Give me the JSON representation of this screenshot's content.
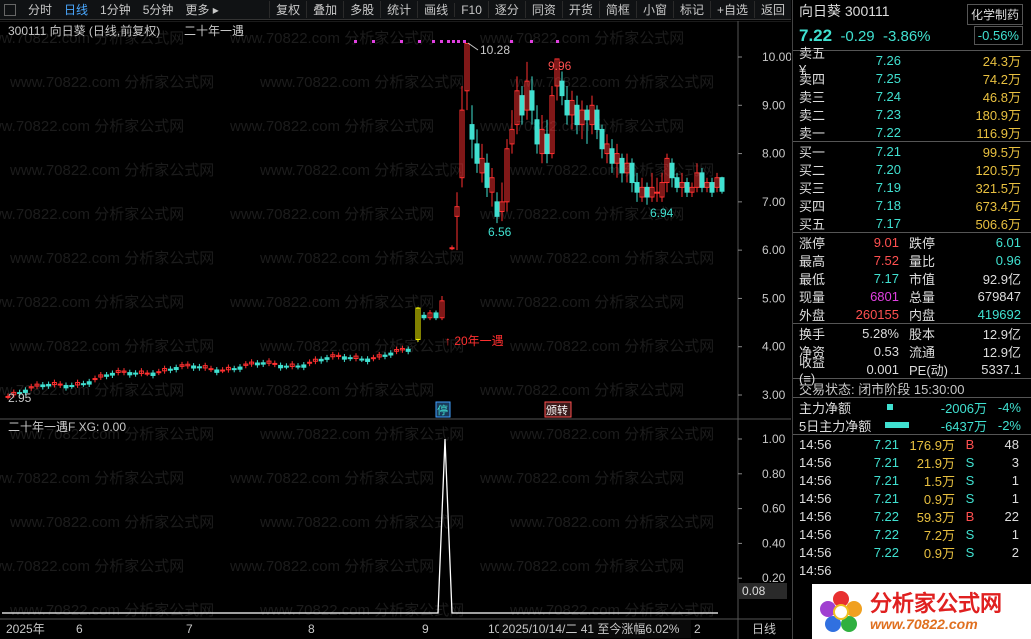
{
  "toolbar": {
    "tabs": [
      "分时",
      "日线",
      "1分钟",
      "5分钟",
      "更多 ▸"
    ],
    "active_tab": "日线",
    "buttons": [
      "复权",
      "叠加",
      "多股",
      "统计",
      "画线",
      "F10",
      "逐分",
      "同资",
      "开货",
      "简框",
      "小窗",
      "标记",
      "+自选",
      "返回"
    ]
  },
  "chart": {
    "title": "300111 向日葵 (日线,前复权)",
    "indicator_name": "二十年一遇",
    "price_ticks": [
      "10.00",
      "9.00",
      "8.00",
      "7.00",
      "6.00",
      "5.00",
      "4.00",
      "3.00"
    ],
    "high_label": "10.28",
    "low_label": "2.95",
    "label_996": "9.96",
    "label_656": "6.56",
    "label_694": "6.94",
    "annotation": "↑ 20年一遇",
    "badge_stop": "停",
    "badge_other": "颁转",
    "ind_title": "二十年一遇F XG: 0.00",
    "ind_ticks": [
      "1.00",
      "0.80",
      "0.60",
      "0.40",
      "0.20"
    ],
    "ind_value": "0.08",
    "x_labels": [
      "2025年",
      "6",
      "7",
      "8",
      "9",
      "10"
    ],
    "period_label": "日线",
    "bottom_info": "2025/10/14/二 41 至今涨幅6.02%",
    "bottom_trail": "2",
    "watermark": "www.70822.com 分析家公式网"
  },
  "quote": {
    "name": "向日葵",
    "code": "300111",
    "sector": "化学制药",
    "price": "7.22",
    "change": "-0.29",
    "change_pct": "-3.86%",
    "box_pct": "-0.56%",
    "asks": [
      {
        "label": "卖五 ¥",
        "price": "7.26",
        "vol": "24.3万"
      },
      {
        "label": "卖四",
        "price": "7.25",
        "vol": "74.2万"
      },
      {
        "label": "卖三",
        "price": "7.24",
        "vol": "46.8万"
      },
      {
        "label": "卖二",
        "price": "7.23",
        "vol": "180.9万"
      },
      {
        "label": "卖一",
        "price": "7.22",
        "vol": "116.9万"
      }
    ],
    "bids": [
      {
        "label": "买一",
        "price": "7.21",
        "vol": "99.5万"
      },
      {
        "label": "买二",
        "price": "7.20",
        "vol": "120.5万"
      },
      {
        "label": "买三",
        "price": "7.19",
        "vol": "321.5万"
      },
      {
        "label": "买四",
        "price": "7.18",
        "vol": "673.4万"
      },
      {
        "label": "买五",
        "price": "7.17",
        "vol": "506.6万"
      }
    ],
    "stats": [
      {
        "k1": "涨停",
        "v1": "9.01",
        "c1": "r",
        "k2": "跌停",
        "v2": "6.01",
        "c2": "g"
      },
      {
        "k1": "最高",
        "v1": "7.52",
        "c1": "r",
        "k2": "量比",
        "v2": "0.96",
        "c2": "g"
      },
      {
        "k1": "最低",
        "v1": "7.17",
        "c1": "g",
        "k2": "市值",
        "v2": "92.9亿",
        "c2": "w"
      },
      {
        "k1": "现量",
        "v1": "6801",
        "c1": "m",
        "k2": "总量",
        "v2": "679847",
        "c2": "w"
      },
      {
        "k1": "外盘",
        "v1": "260155",
        "c1": "r",
        "k2": "内盘",
        "v2": "419692",
        "c2": "g"
      }
    ],
    "stats2": [
      {
        "k1": "换手",
        "v1": "5.28%",
        "k2": "股本",
        "v2": "12.9亿"
      },
      {
        "k1": "净资",
        "v1": "0.53",
        "k2": "流通",
        "v2": "12.9亿"
      },
      {
        "k1": "收益(≡)",
        "v1": "0.001",
        "k2": "PE(动)",
        "v2": "5337.1"
      }
    ],
    "trade_state": "交易状态: 闭市阶段 15:30:00",
    "flows": [
      {
        "label": "主力净额",
        "value": "-2006万",
        "pct": "-4%"
      },
      {
        "label": "5日主力净额",
        "value": "-6437万",
        "pct": "-2%"
      }
    ],
    "ticks": [
      {
        "t": "14:56",
        "p": "7.21",
        "v": "176.9万",
        "s": "B",
        "n": "48"
      },
      {
        "t": "14:56",
        "p": "7.21",
        "v": "21.9万",
        "s": "S",
        "n": "3"
      },
      {
        "t": "14:56",
        "p": "7.21",
        "v": "1.5万",
        "s": "S",
        "n": "1"
      },
      {
        "t": "14:56",
        "p": "7.21",
        "v": "0.9万",
        "s": "S",
        "n": "1"
      },
      {
        "t": "14:56",
        "p": "7.22",
        "v": "59.3万",
        "s": "B",
        "n": "22"
      },
      {
        "t": "14:56",
        "p": "7.22",
        "v": "7.2万",
        "s": "S",
        "n": "1"
      },
      {
        "t": "14:56",
        "p": "7.22",
        "v": "0.9万",
        "s": "S",
        "n": "2"
      },
      {
        "t": "14:56",
        "p": "",
        "v": "",
        "s": "",
        "n": ""
      }
    ]
  },
  "logo": {
    "line1": "分析家公式网",
    "line2": "www.70822.com"
  },
  "colors": {
    "up": "#ff3030",
    "down": "#40e0d0",
    "highlight": "#ffff00",
    "accent": "#4aa8ff"
  }
}
